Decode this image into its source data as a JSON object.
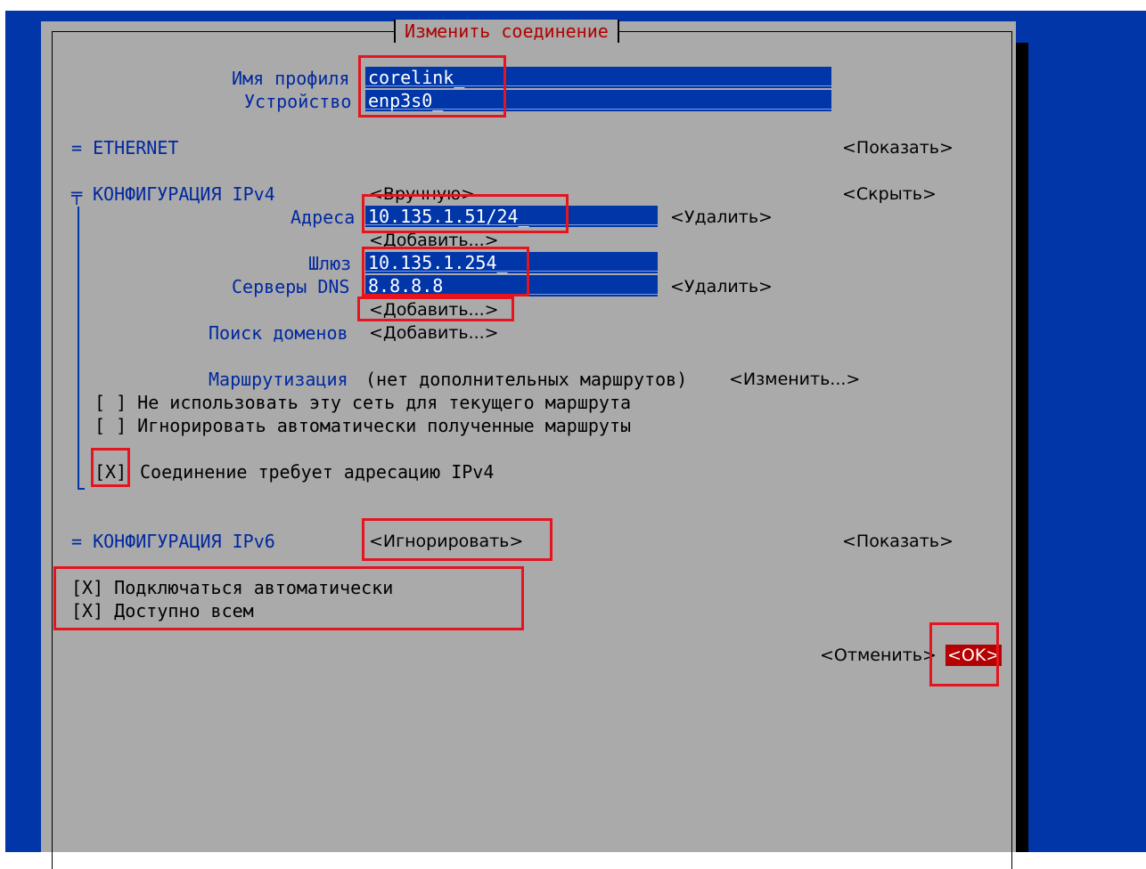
{
  "dialog": {
    "title": "Изменить соединение"
  },
  "profile": {
    "name_label": "Имя профиля",
    "name_value": "corelink_",
    "device_label": "Устройство",
    "device_value": "enp3s0_"
  },
  "ethernet": {
    "label": "= ETHERNET",
    "toggle": "<Показать>"
  },
  "ipv4": {
    "label": "КОНФИГУРАЦИЯ IPv4",
    "method": "<Вручную>",
    "toggle": "<Скрыть>",
    "addresses_label": "Адреса",
    "address_value": "10.135.1.51/24_",
    "remove_label": "<Удалить>",
    "add_label": "<Добавить...>",
    "gateway_label": "Шлюз",
    "gateway_value": "10.135.1.254_",
    "dns_label": "Серверы DNS",
    "dns_value": "8.8.8.8",
    "dns_remove_label": "<Удалить>",
    "dns_add_label": "<Добавить...>",
    "search_label": "Поиск доменов",
    "search_add_label": "<Добавить...>",
    "routing_label": "Маршрутизация",
    "routing_text": "(нет дополнительных маршрутов)",
    "routing_edit": "<Изменить...>",
    "never_default": "[ ] Не использовать эту сеть для текущего маршрута",
    "ignore_routes": "[ ] Игнорировать автоматически полученные маршруты",
    "require_checkbox": "[X]",
    "require_text": "Соединение требует адресацию IPv4"
  },
  "ipv6": {
    "label": "= КОНФИГУРАЦИЯ IPv6",
    "method": "<Игнорировать>",
    "toggle": "<Показать>"
  },
  "options": {
    "autoconnect": "[X] Подключаться автоматически",
    "all_users": "[X] Доступно всем"
  },
  "actions": {
    "cancel": "<Отменить>",
    "ok": "<OK>"
  },
  "colors": {
    "background": "#0036a8",
    "dialog": "#aaaaaa",
    "label": "#0028a0",
    "title": "#b00000",
    "highlight": "#e5141e"
  }
}
